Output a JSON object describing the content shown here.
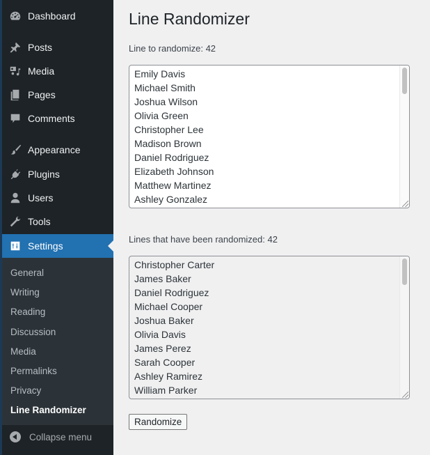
{
  "sidebar": {
    "items": [
      {
        "label": "Dashboard",
        "icon": "dashboard-icon"
      },
      {
        "label": "Posts",
        "icon": "pushpin-icon"
      },
      {
        "label": "Media",
        "icon": "media-icon"
      },
      {
        "label": "Pages",
        "icon": "pages-icon"
      },
      {
        "label": "Comments",
        "icon": "comment-icon"
      },
      {
        "label": "Appearance",
        "icon": "paintbrush-icon"
      },
      {
        "label": "Plugins",
        "icon": "plugin-icon"
      },
      {
        "label": "Users",
        "icon": "user-icon"
      },
      {
        "label": "Tools",
        "icon": "wrench-icon"
      },
      {
        "label": "Settings",
        "icon": "settings-sliders-icon",
        "active": true
      }
    ],
    "submenu": [
      {
        "label": "General"
      },
      {
        "label": "Writing"
      },
      {
        "label": "Reading"
      },
      {
        "label": "Discussion"
      },
      {
        "label": "Media"
      },
      {
        "label": "Permalinks"
      },
      {
        "label": "Privacy"
      },
      {
        "label": "Line Randomizer",
        "current": true
      }
    ],
    "collapse_label": "Collapse menu",
    "accent_color": "#2271b1"
  },
  "main": {
    "title": "Line Randomizer",
    "input_label": "Line to randomize: 42",
    "input_lines": [
      "Emily Davis",
      "Michael Smith",
      "Joshua Wilson",
      "Olivia Green",
      "Christopher Lee",
      "Madison Brown",
      "Daniel Rodriguez",
      "Elizabeth Johnson",
      "Matthew Martinez",
      "Ashley Gonzalez"
    ],
    "output_label": "Lines that have been randomized: 42",
    "output_lines": [
      "Christopher Carter",
      "James Baker",
      "Daniel Rodriguez",
      "Michael Cooper",
      "Joshua Baker",
      "Olivia Davis",
      "James Perez",
      "Sarah Cooper",
      "Ashley Ramirez",
      "William Parker"
    ],
    "button_label": "Randomize"
  }
}
